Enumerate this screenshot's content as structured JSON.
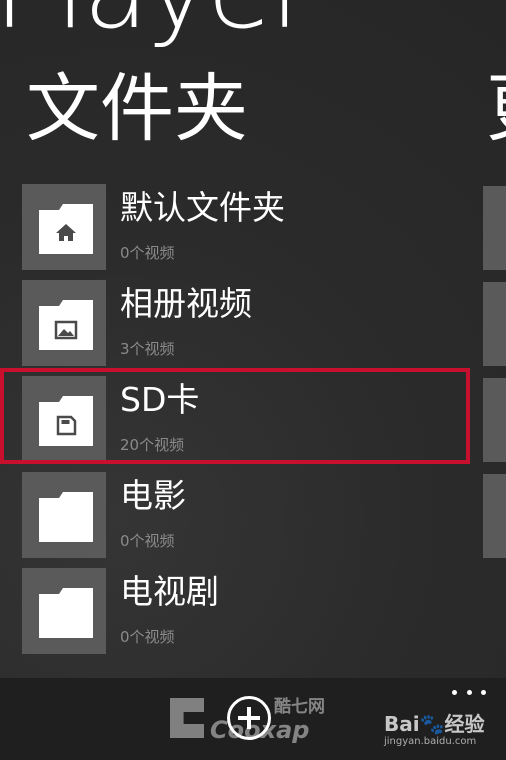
{
  "app": {
    "title": "Player"
  },
  "header": {
    "section_title": "文件夹",
    "next_section_title": "更"
  },
  "folders": [
    {
      "name": "默认文件夹",
      "count": "0个视频",
      "icon": "home-icon"
    },
    {
      "name": "相册视频",
      "count": "3个视频",
      "icon": "picture-icon"
    },
    {
      "name": "SD卡",
      "count": "20个视频",
      "icon": "sd-card-icon"
    },
    {
      "name": "电影",
      "count": "0个视频",
      "icon": "folder-icon"
    },
    {
      "name": "电视剧",
      "count": "0个视频",
      "icon": "folder-icon"
    }
  ],
  "selected_index": 2,
  "colors": {
    "background": "#2a2a2a",
    "tile": "#5a5a5a",
    "highlight": "#c8102e",
    "count_text": "#8a8a8a",
    "app_bar": "#1f1f1f"
  },
  "app_bar": {
    "add_icon": "add-circle-icon",
    "more_icon": "more-dots-icon"
  },
  "watermarks": {
    "cool_cn": "酷七网",
    "cool_en": "Cooxap",
    "baidu_logo": "Bai🐾经验",
    "baidu_url": "jingyan.baidu.com"
  }
}
